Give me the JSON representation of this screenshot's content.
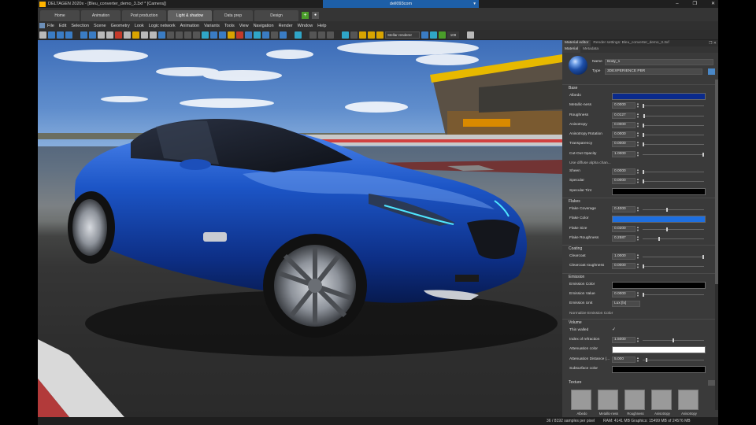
{
  "window": {
    "title": "DELTAGEN 2020x - [Bleu_converter_demo_3.3xf * [Camera]]",
    "remote_session": "dell093com"
  },
  "workspace_tabs": [
    {
      "label": "Home",
      "active": false
    },
    {
      "label": "Animation",
      "active": false
    },
    {
      "label": "Post production",
      "active": false
    },
    {
      "label": "Light & shadow",
      "active": true
    },
    {
      "label": "Data prep",
      "active": false
    },
    {
      "label": "Design",
      "active": false
    }
  ],
  "menu": [
    "File",
    "Edit",
    "Selection",
    "Scene",
    "Geometry",
    "Look",
    "Logic network",
    "Animation",
    "Variants",
    "Tools",
    "View",
    "Navigation",
    "Render",
    "Window",
    "Help"
  ],
  "toolbar": {
    "renderer_select": "Stellar renderer",
    "counter": "109"
  },
  "panel": {
    "tabs": [
      {
        "label": "Material editor",
        "active": true
      },
      {
        "label": "Render settings: Bleu_converter_demo_3.3xf",
        "active": false
      }
    ],
    "subtabs": [
      {
        "label": "Material",
        "active": true
      },
      {
        "label": "Metadata",
        "active": false
      }
    ],
    "name_label": "Name",
    "name_value": "Body_1",
    "type_label": "Type",
    "type_value": "3DEXPERIENCE PBR",
    "groups": {
      "base": {
        "title": "Base",
        "props": [
          {
            "label": "Albedo",
            "kind": "color",
            "color": "#0a2a8c"
          },
          {
            "label": "Metallic-ness",
            "kind": "num",
            "value": "0.0000",
            "level": 0.0
          },
          {
            "label": "Roughness",
            "kind": "num",
            "value": "0.0127",
            "level": 0.01
          },
          {
            "label": "Anisotropy",
            "kind": "num",
            "value": "0.0000",
            "level": 0.0
          },
          {
            "label": "Anisotropy Rotation",
            "kind": "num",
            "value": "0.0000",
            "level": 0.0
          },
          {
            "label": "Transparency",
            "kind": "num",
            "value": "0.0000",
            "level": 0.0
          },
          {
            "label": "Cut-Out Opacity",
            "kind": "num",
            "value": "1.0000",
            "level": 1.0
          },
          {
            "label": "Use diffuse alpha chan...",
            "kind": "text"
          },
          {
            "label": "Sheen",
            "kind": "num",
            "value": "0.0000",
            "level": 0.0
          },
          {
            "label": "Specular",
            "kind": "num",
            "value": "0.0000",
            "level": 0.0
          },
          {
            "label": "Specular Tint",
            "kind": "color",
            "color": "#000000"
          }
        ]
      },
      "flakes": {
        "title": "Flakes",
        "props": [
          {
            "label": "Flake Coverage",
            "kind": "num",
            "value": "0.4000",
            "level": 0.4
          },
          {
            "label": "Flake Color",
            "kind": "color",
            "color": "#1e6fe0"
          },
          {
            "label": "Flake Size",
            "kind": "num",
            "value": "0.0200",
            "level": 0.4
          },
          {
            "label": "Flake Roughness",
            "kind": "num",
            "value": "0.2587",
            "level": 0.26
          }
        ]
      },
      "coating": {
        "title": "Coating",
        "props": [
          {
            "label": "Clearcoat",
            "kind": "num",
            "value": "1.0000",
            "level": 1.0
          },
          {
            "label": "Clearcoat roughness",
            "kind": "num",
            "value": "0.0000",
            "level": 0.0
          }
        ]
      },
      "emission": {
        "title": "Emission",
        "props": [
          {
            "label": "Emission Color",
            "kind": "color",
            "color": "#000000"
          },
          {
            "label": "Emission Value",
            "kind": "num",
            "value": "0.0000",
            "level": 0.0
          },
          {
            "label": "Emission Unit",
            "kind": "select",
            "value": "Lux [lx]"
          },
          {
            "label": "Normalize Emission Color",
            "kind": "text"
          }
        ]
      },
      "volume": {
        "title": "Volume",
        "props": [
          {
            "label": "Thin walled",
            "kind": "check",
            "value": "✓"
          },
          {
            "label": "Index of refraction",
            "kind": "num",
            "value": "1.5000",
            "level": 0.5
          },
          {
            "label": "Attenuation color",
            "kind": "color",
            "color": "#ffffff"
          },
          {
            "label": "Attenuation Distance (...",
            "kind": "num",
            "value": "5.000",
            "level": 0.05
          },
          {
            "label": "Subsurface color",
            "kind": "color",
            "color": "#000000"
          }
        ]
      }
    },
    "texture": {
      "title": "Texture",
      "slots": [
        "Albedo",
        "Metallic-ness",
        "Roughness",
        "Anisotropy",
        "Anisotropy"
      ]
    }
  },
  "status": {
    "samples": "36 / 8192 samples per pixel",
    "memory": "RAM: 4141 MB Graphics: 15499 MB of 24576 MB"
  }
}
